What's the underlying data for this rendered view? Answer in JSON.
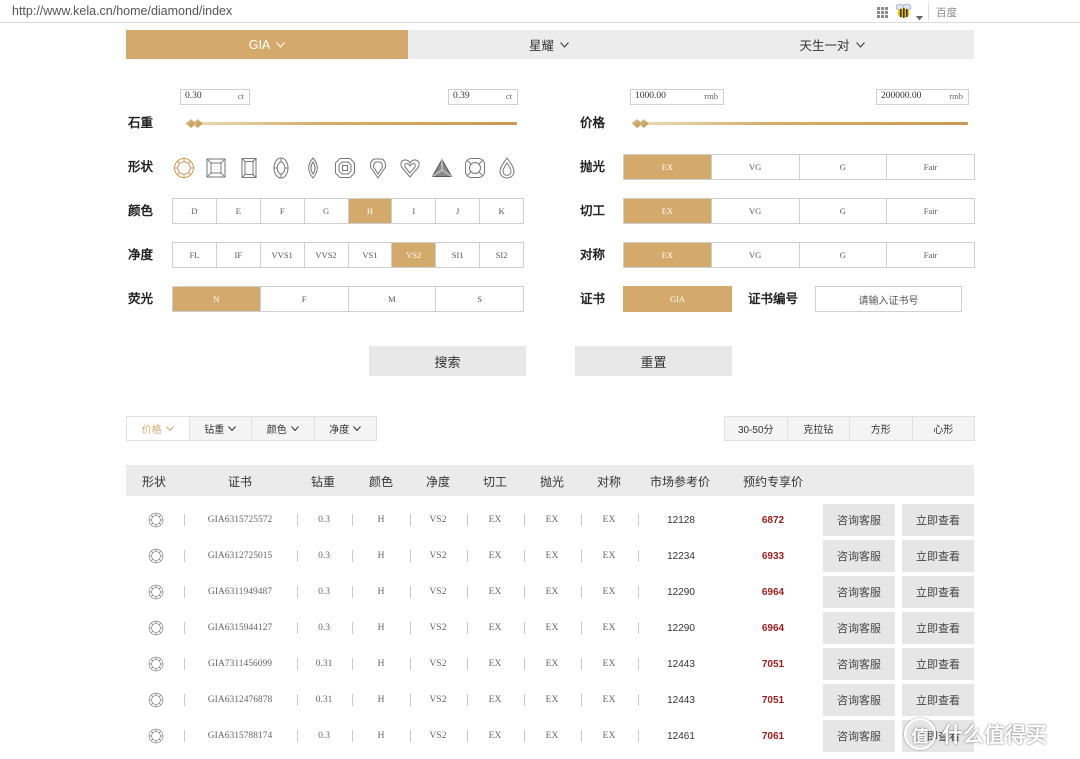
{
  "browser": {
    "url": "http://www.kela.cn/home/diamond/index",
    "search_placeholder": "百度"
  },
  "colors": {
    "accent": "#d4aa6c",
    "tab_bg": "#ececec",
    "member_price": "#9b1c1c",
    "button_gray": "#e6e6e6"
  },
  "tabs": [
    {
      "label": "GIA",
      "active": true
    },
    {
      "label": "星耀",
      "active": false
    },
    {
      "label": "天生一对",
      "active": false
    }
  ],
  "filters": {
    "weight": {
      "label": "石重",
      "min": "0.30",
      "max": "0.39",
      "unit": "ct",
      "handles": [
        0,
        0.02
      ]
    },
    "price": {
      "label": "价格",
      "min": "1000.00",
      "max": "200000.00",
      "unit": "rmb",
      "handles": [
        0,
        0.02
      ]
    },
    "shape": {
      "label": "形状",
      "icons": [
        "round-icon",
        "princess-icon",
        "emerald-icon",
        "oval-icon",
        "marquise-icon",
        "asscher-icon",
        "shield-icon",
        "heart-icon",
        "triangle-icon",
        "cushion-icon",
        "pear-icon"
      ],
      "selected": "round-icon"
    },
    "color": {
      "label": "颜色",
      "options": [
        "D",
        "E",
        "F",
        "G",
        "H",
        "I",
        "J",
        "K"
      ],
      "selected": "H"
    },
    "clarity": {
      "label": "净度",
      "options": [
        "FL",
        "IF",
        "VVS1",
        "VVS2",
        "VS1",
        "VS2",
        "SI1",
        "SI2"
      ],
      "selected": "VS2"
    },
    "fluorescence": {
      "label": "荧光",
      "options": [
        "N",
        "F",
        "M",
        "S"
      ],
      "selected": "N"
    },
    "polish": {
      "label": "抛光",
      "options": [
        "EX",
        "VG",
        "G",
        "Fair"
      ],
      "selected": "EX"
    },
    "cut": {
      "label": "切工",
      "options": [
        "EX",
        "VG",
        "G",
        "Fair"
      ],
      "selected": "EX"
    },
    "symmetry": {
      "label": "对称",
      "options": [
        "EX",
        "VG",
        "G",
        "Fair"
      ],
      "selected": "EX"
    },
    "certificate": {
      "label": "证书",
      "options": [
        "GIA"
      ],
      "selected": "GIA"
    },
    "certificate_number": {
      "label": "证书编号",
      "placeholder": "请输入证书号"
    }
  },
  "actions": {
    "search": "搜索",
    "reset": "重置"
  },
  "sort": {
    "fields": [
      {
        "label": "价格",
        "active": true
      },
      {
        "label": "钻重",
        "active": false
      },
      {
        "label": "颜色",
        "active": false
      },
      {
        "label": "净度",
        "active": false
      }
    ],
    "quick_filters": [
      "30-50分",
      "克拉钻",
      "方形",
      "心形"
    ]
  },
  "table": {
    "headers": [
      "形状",
      "证书",
      "钻重",
      "颜色",
      "净度",
      "切工",
      "抛光",
      "对称",
      "市场参考价",
      "预约专享价"
    ],
    "consult_label": "咨询客服",
    "view_label": "立即查看",
    "rows": [
      {
        "shape_icon": "round-icon",
        "cert": "GIA6315725572",
        "carat": "0.3",
        "color": "H",
        "clarity": "VS2",
        "cut": "EX",
        "polish": "EX",
        "symmetry": "EX",
        "market_price": "12128",
        "member_price": "6872"
      },
      {
        "shape_icon": "round-icon",
        "cert": "GIA6312725015",
        "carat": "0.3",
        "color": "H",
        "clarity": "VS2",
        "cut": "EX",
        "polish": "EX",
        "symmetry": "EX",
        "market_price": "12234",
        "member_price": "6933"
      },
      {
        "shape_icon": "round-icon",
        "cert": "GIA6311949487",
        "carat": "0.3",
        "color": "H",
        "clarity": "VS2",
        "cut": "EX",
        "polish": "EX",
        "symmetry": "EX",
        "market_price": "12290",
        "member_price": "6964"
      },
      {
        "shape_icon": "round-icon",
        "cert": "GIA6315944127",
        "carat": "0.3",
        "color": "H",
        "clarity": "VS2",
        "cut": "EX",
        "polish": "EX",
        "symmetry": "EX",
        "market_price": "12290",
        "member_price": "6964"
      },
      {
        "shape_icon": "round-icon",
        "cert": "GIA7311456099",
        "carat": "0.31",
        "color": "H",
        "clarity": "VS2",
        "cut": "EX",
        "polish": "EX",
        "symmetry": "EX",
        "market_price": "12443",
        "member_price": "7051"
      },
      {
        "shape_icon": "round-icon",
        "cert": "GIA6312476878",
        "carat": "0.31",
        "color": "H",
        "clarity": "VS2",
        "cut": "EX",
        "polish": "EX",
        "symmetry": "EX",
        "market_price": "12443",
        "member_price": "7051"
      },
      {
        "shape_icon": "round-icon",
        "cert": "GIA6315788174",
        "carat": "0.3",
        "color": "H",
        "clarity": "VS2",
        "cut": "EX",
        "polish": "EX",
        "symmetry": "EX",
        "market_price": "12461",
        "member_price": "7061"
      }
    ]
  },
  "watermark": {
    "logo_char": "值",
    "text": "什么值得买"
  }
}
